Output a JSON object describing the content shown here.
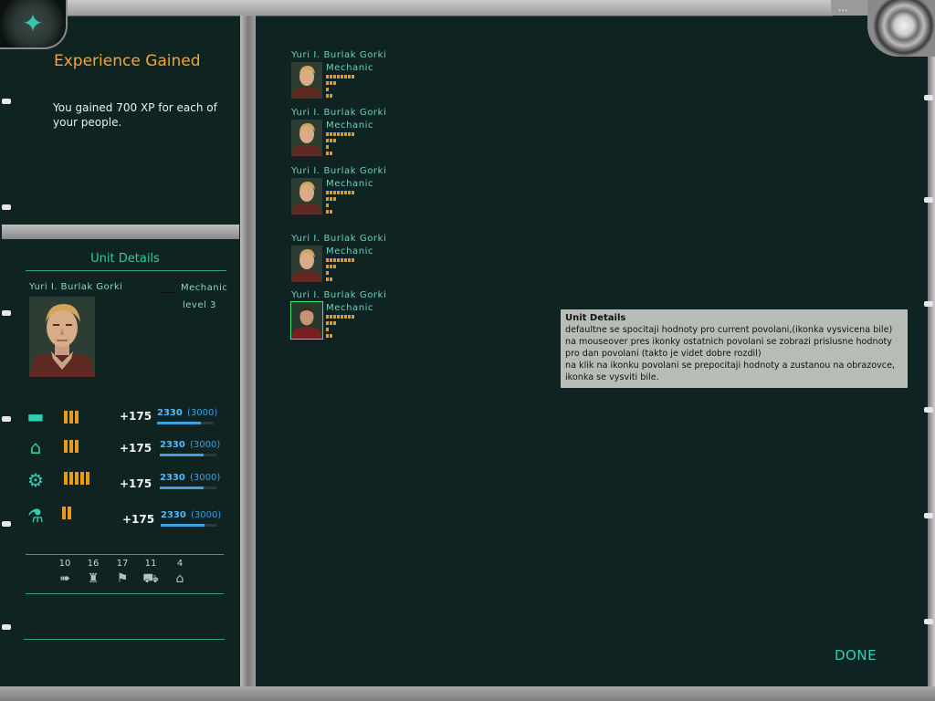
{
  "corner_badge": "...",
  "experience": {
    "title": "Experience Gained",
    "message": "You gained 700 XP for each of your people."
  },
  "unit_details": {
    "title": "Unit Details",
    "name": "Yuri I. Burlak Gorki",
    "profession": "Mechanic",
    "level": "level 3",
    "skills": [
      {
        "icon": "rifle-icon",
        "bars": 3,
        "gain": "+175",
        "value": "2330",
        "max": "(3000)",
        "progress": 0.78
      },
      {
        "icon": "garage-icon",
        "bars": 3,
        "gain": "+175",
        "value": "2330",
        "max": "(3000)",
        "progress": 0.78
      },
      {
        "icon": "machinery-icon",
        "bars": 5,
        "gain": "+175",
        "value": "2330",
        "max": "(3000)",
        "progress": 0.78
      },
      {
        "icon": "flask-icon",
        "bars": 2,
        "gain": "+175",
        "value": "2330",
        "max": "(3000)",
        "progress": 0.78
      }
    ],
    "stats": [
      {
        "value": "10",
        "icon": "speed-arrows-icon"
      },
      {
        "value": "16",
        "icon": "armor-shirt-icon"
      },
      {
        "value": "17",
        "icon": "running-people-icon"
      },
      {
        "value": "11",
        "icon": "vehicle-icon"
      },
      {
        "value": "4",
        "icon": "building-icon"
      }
    ]
  },
  "people": [
    {
      "name": "Yuri I. Burlak Gorki",
      "profession": "Mechanic",
      "selected": false
    },
    {
      "name": "Yuri I. Burlak Gorki",
      "profession": "Mechanic",
      "selected": false
    },
    {
      "name": "Yuri I. Burlak Gorki",
      "profession": "Mechanic",
      "selected": false
    },
    {
      "name": "Yuri I. Burlak Gorki",
      "profession": "Mechanic",
      "selected": false
    },
    {
      "name": "Yuri I. Burlak Gorki",
      "profession": "Mechanic",
      "selected": true
    }
  ],
  "tooltip": {
    "title": "Unit Details",
    "lines": [
      "defaultne se spocitaji hodnoty pro current povolani,(ikonka vysvicena bile)",
      "na mouseover pres ikonky ostatnich povolani se zobrazi prislusne hodnoty",
      "pro dan povolani (takto je videt dobre rozdil)",
      "na klik na ikonku povolani  se prepocitaji hodnoty a zustanou na obrazovce,",
      "ikonka se vysviti bile."
    ]
  },
  "done_label": "DONE",
  "colors": {
    "accent": "#2fd1b4",
    "orange": "#f6a532",
    "bar": "#e89b18",
    "background": "#0f2422"
  }
}
